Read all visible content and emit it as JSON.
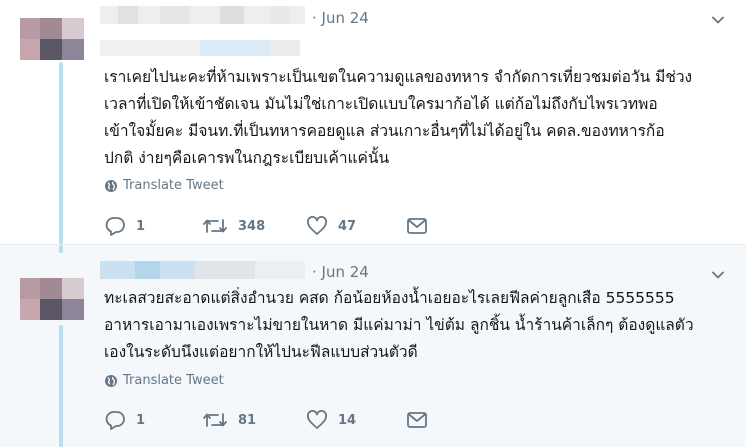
{
  "tweets": [
    {
      "time": "· Jun 24",
      "lines": [
        "เราเคยไปนะคะที่ห้ามเพราะเป็นเขตในความดูแลของทหาร จำกัดการเที่ยวชมต่อวัน มีช่วง",
        "เวลาที่เปิดให้เข้าชัดเจน มันไม่ใช่เกาะเปิดแบบใครมาก้อได้ แต่ก้อไม่ถึงกับไพรเวทพอ",
        "เข้าใจมั้ยคะ มีจนท.ที่เป็นทหารคอยดูแล ส่วนเกาะอื่นๆที่ไม่ได้อยู่ใน คดล.ของทหารก้อ",
        "ปกติ ง่ายๆคือเคารพในกฎระเบียบเค้าแค่นั้น"
      ],
      "translate": "Translate Tweet",
      "replies": "1",
      "retweets": "348",
      "likes": "47"
    },
    {
      "time": "· Jun 24",
      "lines": [
        "ทะเลสวยสะอาดแต่สิ่งอำนวย คสด ก้อน้อยห้องน้ำเอยอะไรเลยฟีลค่ายลูกเสือ 5555555",
        "อาหารเอามาเองเพราะไม่ขายในหาด มีแค่มาม่า ไข่ต้ม ลูกชิ้น น้ำร้านค้าเล็กๆ ต้องดูแลตัว",
        "เองในระดับนึงแต่อยากให้ไปนะฟีลแบบส่วนตัวดี"
      ],
      "translate": "Translate Tweet",
      "replies": "1",
      "retweets": "81",
      "likes": "14"
    }
  ],
  "colors": {
    "text": "#14171a",
    "muted": "#657786",
    "thread_line": "#b3def4",
    "highlight_bg": "#f5f8fa"
  }
}
